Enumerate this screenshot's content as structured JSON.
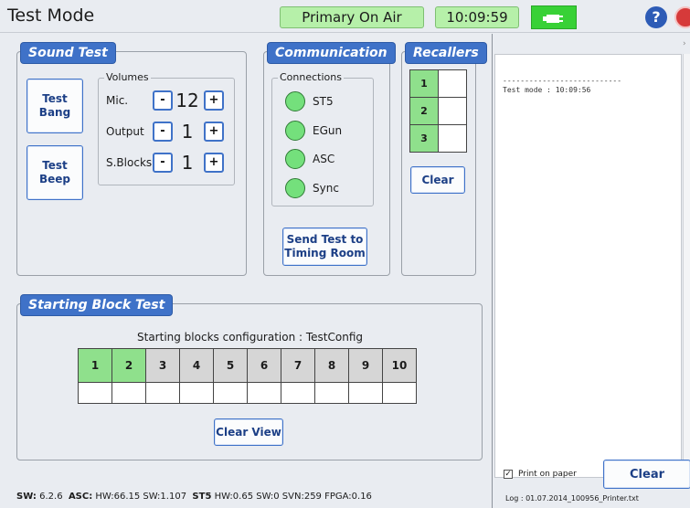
{
  "header": {
    "title": "Test Mode",
    "on_air": "Primary On Air",
    "time": "10:09:59"
  },
  "sound_test": {
    "title": "Sound Test",
    "test_bang": "Test\nBang",
    "test_beep": "Test\nBeep",
    "volumes_title": "Volumes",
    "volumes": [
      {
        "label": "Mic.",
        "value": "12"
      },
      {
        "label": "Output",
        "value": "1"
      },
      {
        "label": "S.Blocks",
        "value": "1"
      }
    ],
    "minus": "-",
    "plus": "+"
  },
  "communication": {
    "title": "Communication",
    "connections_title": "Connections",
    "connections": [
      "ST5",
      "EGun",
      "ASC",
      "Sync"
    ],
    "send_button": "Send Test to\nTiming Room"
  },
  "recallers": {
    "title": "Recallers",
    "numbers": [
      "1",
      "2",
      "3"
    ],
    "clear": "Clear"
  },
  "starting_block": {
    "title": "Starting Block Test",
    "config_text": "Starting blocks configuration : TestConfig",
    "blocks": [
      "1",
      "2",
      "3",
      "4",
      "5",
      "6",
      "7",
      "8",
      "9",
      "10"
    ],
    "active_count": 2,
    "clear_view": "Clear View"
  },
  "log": {
    "lines": [
      "---------------------------",
      "Test mode : 10:09:56"
    ],
    "print_on_paper": "Print on paper",
    "print_checked": true,
    "clear": "Clear",
    "filename": "Log : 01.07.2014_100956_Printer.txt"
  },
  "status": {
    "sw_label": "SW:",
    "sw_value": "6.2.6",
    "asc_label": "ASC:",
    "asc_value": "HW:66.15 SW:1.107",
    "st5_label": "ST5",
    "st5_value": "HW:0.65 SW:0 SVN:259 FPGA:0.16"
  },
  "colors": {
    "accent": "#3f72c8",
    "active_green": "#8fe08c",
    "led_green": "#74e07c"
  }
}
